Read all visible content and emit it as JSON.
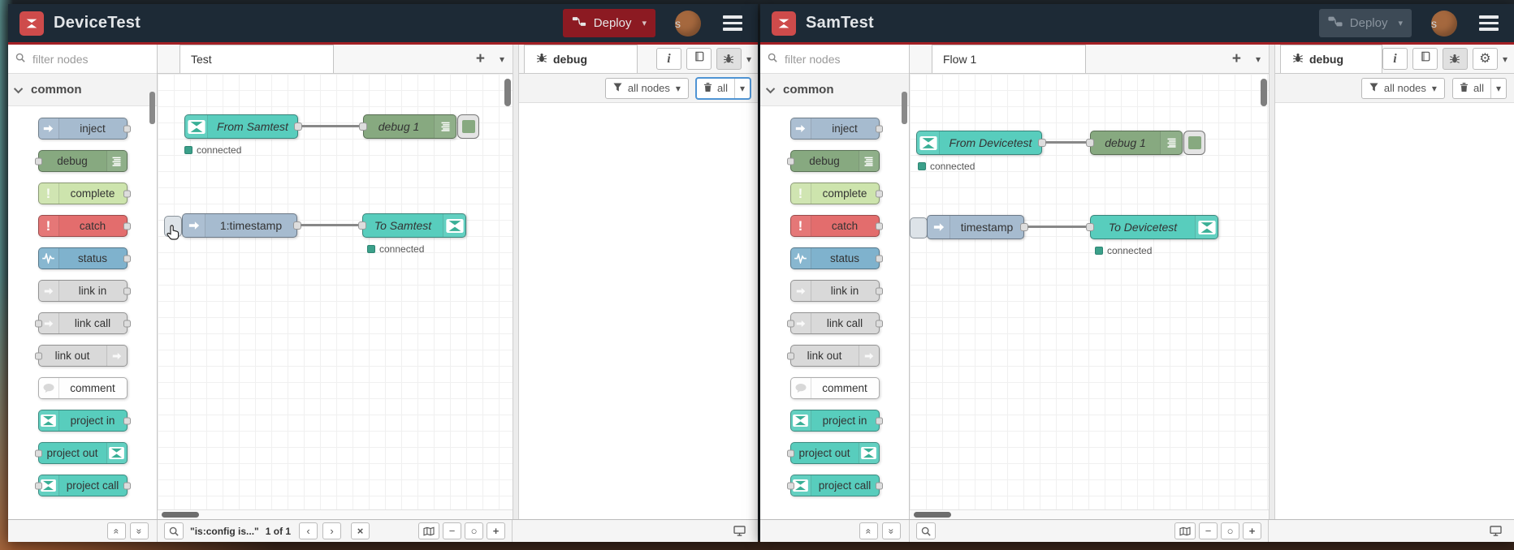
{
  "colors": {
    "header_bg": "#1d2a36",
    "header_red_line": "#a32025",
    "deploy_red": "#8c1a22",
    "deploy_disabled_bg": "#3d4a56",
    "avatar_brown": "#a5683e",
    "node_project_teal": "#58cdbd",
    "node_debug_green": "#87a980",
    "node_inject_grey": "#a6bbcf",
    "node_complete": "#cde4ad",
    "node_catch": "#e36d6d",
    "node_status": "#7fb2cd",
    "node_link": "#d9d9d9",
    "node_comment": "#fefefe",
    "status_dot_teal": "#3ba08a"
  },
  "icons": {
    "plus": "+",
    "caret": "▾",
    "minus": "−",
    "zoom_reset": "○",
    "close": "×",
    "prev": "‹",
    "next": "›",
    "info": "i",
    "gear": "⚙",
    "collapse_up": "«",
    "collapse_down": "»",
    "exclamation": "!"
  },
  "palette": {
    "filter_placeholder": "filter nodes",
    "category_label": "common",
    "items": [
      {
        "label": "inject"
      },
      {
        "label": "debug"
      },
      {
        "label": "complete"
      },
      {
        "label": "catch"
      },
      {
        "label": "status"
      },
      {
        "label": "link in"
      },
      {
        "label": "link call"
      },
      {
        "label": "link out"
      },
      {
        "label": "comment"
      },
      {
        "label": "project in"
      },
      {
        "label": "project out"
      },
      {
        "label": "project call"
      }
    ]
  },
  "debug_panel": {
    "tab_label": "debug",
    "filter_button_label": "all nodes",
    "clear_button_label": "all"
  },
  "windows": [
    {
      "title": "DeviceTest",
      "deploy_label": "Deploy",
      "deploy_enabled": true,
      "avatar_letter": "s",
      "workspace_tab": "Test",
      "flow": {
        "row1": {
          "source": "From Samtest",
          "target": "debug 1",
          "status": "connected"
        },
        "row2": {
          "source": "1:timestamp",
          "target": "To Samtest",
          "status": "connected"
        }
      },
      "footer": {
        "search_query": "\"is:config is...\"",
        "search_count": "1 of 1"
      }
    },
    {
      "title": "SamTest",
      "deploy_label": "Deploy",
      "deploy_enabled": false,
      "avatar_letter": "s",
      "workspace_tab": "Flow 1",
      "flow": {
        "row1": {
          "source": "From Devicetest",
          "target": "debug 1",
          "status": "connected"
        },
        "row2": {
          "source": "timestamp",
          "target": "To Devicetest",
          "status": "connected"
        }
      },
      "footer": {}
    }
  ]
}
